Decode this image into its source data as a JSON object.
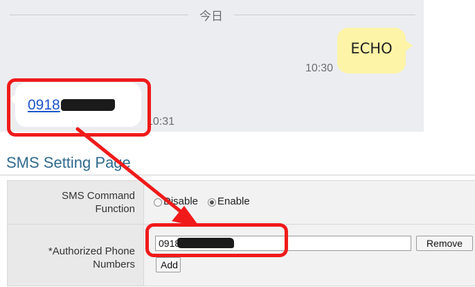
{
  "chat": {
    "date_label": "今日",
    "outgoing": {
      "text": "ECHO",
      "time": "10:30"
    },
    "incoming": {
      "phone_prefix": "0918",
      "time": "10:31"
    }
  },
  "sms_page": {
    "title": "SMS Setting Page",
    "command_function": {
      "label_line1": "SMS Command",
      "label_line2": "Function",
      "options": [
        "Disable",
        "Enable"
      ],
      "selected": "Enable"
    },
    "authorized": {
      "label_line1": "*Authorized Phone",
      "label_line2": "Numbers",
      "phone_value": "0918",
      "remove_label": "Remove",
      "add_label": "Add"
    }
  },
  "colors": {
    "highlight": "#f01a1a",
    "outgoing_bubble": "#fdf4a7",
    "link": "#1a55cc",
    "page_title": "#2f6a8e"
  }
}
